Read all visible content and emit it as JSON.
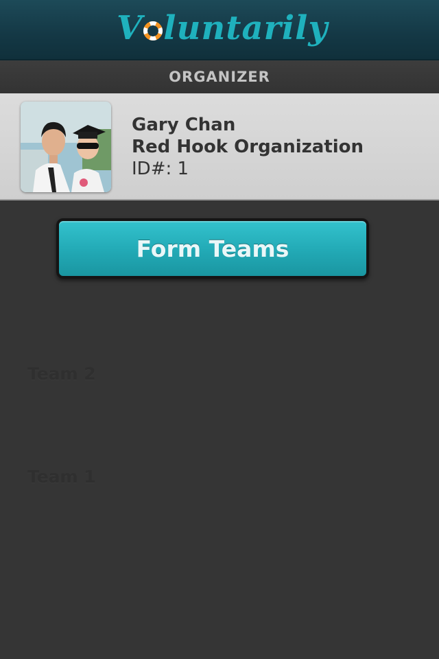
{
  "header": {
    "logo_text_pre": "V",
    "logo_text_post": "luntarily",
    "logo_icon": "life-ring-icon"
  },
  "section": {
    "title": "ORGANIZER"
  },
  "profile": {
    "name": "Gary Chan",
    "organization": "Red Hook Organization",
    "id_line": "ID#: 1",
    "avatar": "profile-photo"
  },
  "actions": {
    "form_teams_label": "Form Teams"
  },
  "teams": [
    {
      "label": "Team 2"
    },
    {
      "label": "Team 1"
    }
  ],
  "colors": {
    "accent_teal": "#22a9b5",
    "header_bg": "#143845",
    "body_bg": "#353535",
    "card_bg": "#d6d6d6",
    "life_ring_orange": "#f39321"
  }
}
